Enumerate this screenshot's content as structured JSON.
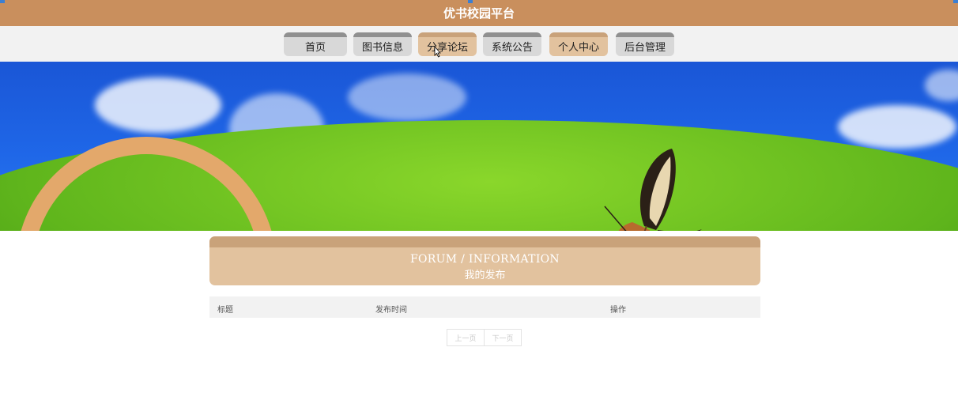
{
  "header": {
    "title": "优书校园平台"
  },
  "nav": {
    "items": [
      {
        "label": "首页",
        "active": false
      },
      {
        "label": "图书信息",
        "active": false
      },
      {
        "label": "分享论坛",
        "active": true
      },
      {
        "label": "系统公告",
        "active": false
      },
      {
        "label": "个人中心",
        "active": true
      },
      {
        "label": "后台管理",
        "active": false
      }
    ]
  },
  "panel": {
    "title_en": "FORUM / INFORMATION",
    "title_cn": "我的发布"
  },
  "table": {
    "headers": [
      "标题",
      "发布时间",
      "操作"
    ]
  },
  "pager": {
    "prev_label": "上一页",
    "next_label": "下一页"
  },
  "colors": {
    "header_bg": "#c98f5d",
    "nav_active": "#e2c29e",
    "nav_inactive": "#d8d8d8"
  }
}
